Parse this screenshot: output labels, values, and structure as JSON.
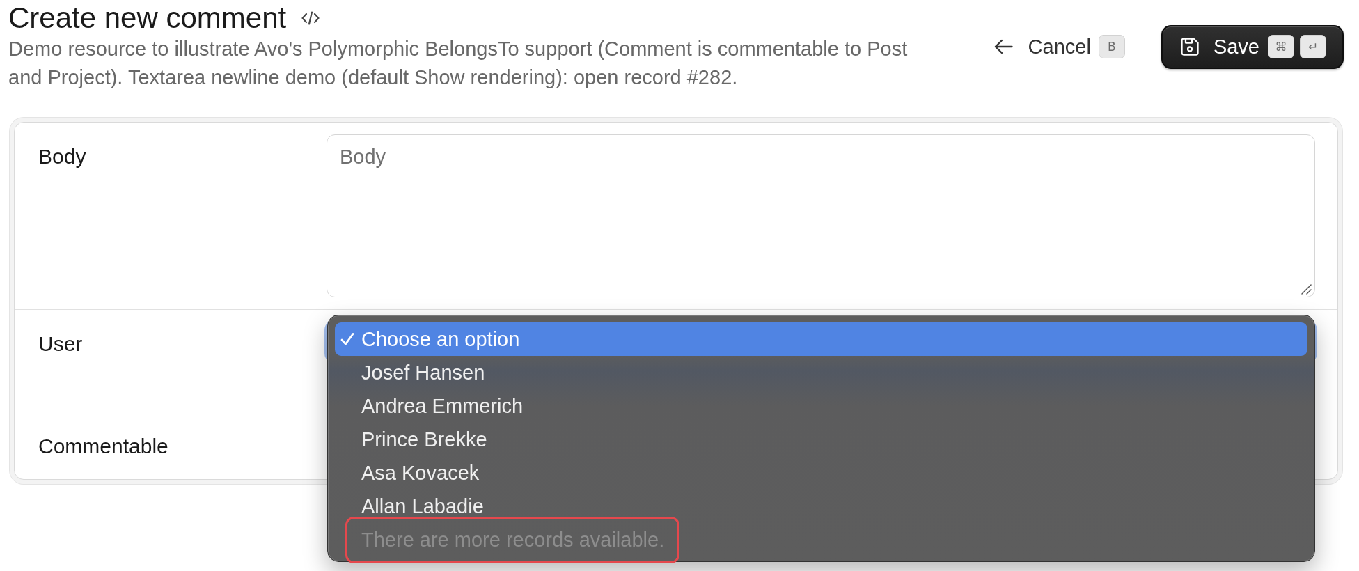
{
  "header": {
    "title": "Create new comment",
    "description": "Demo resource to illustrate Avo's Polymorphic BelongsTo support (Comment is commentable to Post and Project). Textarea newline demo (default Show rendering): open record #282."
  },
  "actions": [
    {
      "kind": "cancel",
      "label": "Cancel",
      "keys": [
        "B"
      ]
    },
    {
      "kind": "save",
      "label": "Save",
      "keys": [
        "⌘",
        "↵"
      ]
    }
  ],
  "form": {
    "fields": [
      {
        "label": "Body",
        "kind": "textarea",
        "placeholder": "Body"
      },
      {
        "label": "User",
        "kind": "select",
        "focused": true,
        "options": [
          {
            "kind": "option",
            "label": "Choose an option",
            "selected": true,
            "highlighted": false
          },
          {
            "kind": "option",
            "label": "Josef Hansen",
            "selected": false,
            "highlighted": false
          },
          {
            "kind": "option",
            "label": "Andrea Emmerich",
            "selected": false,
            "highlighted": false
          },
          {
            "kind": "option",
            "label": "Prince Brekke",
            "selected": false,
            "highlighted": false
          },
          {
            "kind": "option",
            "label": "Asa Kovacek",
            "selected": false,
            "highlighted": false
          },
          {
            "kind": "option",
            "label": "Allan Labadie",
            "selected": false,
            "highlighted": false
          },
          {
            "kind": "note",
            "label": "There are more records available.",
            "selected": false,
            "highlighted": true
          }
        ]
      },
      {
        "label": "Commentable"
      }
    ]
  }
}
